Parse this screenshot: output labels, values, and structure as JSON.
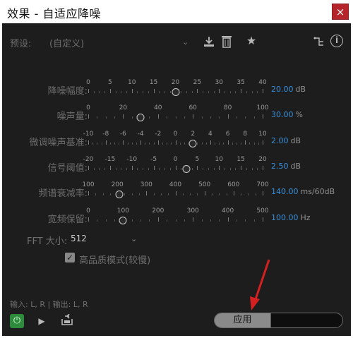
{
  "window": {
    "title": "效果 - 自适应降噪",
    "close_glyph": "×"
  },
  "toolbar": {
    "preset_label": "预设:",
    "preset_value": "(自定义)",
    "icons": [
      "chevron-down-icon",
      "download-icon",
      "trash-icon",
      "star-icon",
      "routing-icon",
      "info-icon"
    ]
  },
  "sliders": [
    {
      "label": "降噪幅度:",
      "ticks": [
        "0",
        "5",
        "10",
        "15",
        "20",
        "25",
        "30",
        "35",
        "40"
      ],
      "value": "20.00",
      "unit": "dB",
      "knob_fraction": 0.5
    },
    {
      "label": "噪声量:",
      "ticks": [
        "0",
        "20",
        "40",
        "60",
        "80",
        "100"
      ],
      "value": "30.00",
      "unit": "%",
      "knob_fraction": 0.3
    },
    {
      "label": "微调噪声基准:",
      "ticks": [
        "-10",
        "-8",
        "-6",
        "-4",
        "-2",
        "0",
        "2",
        "4",
        "6",
        "8",
        "10"
      ],
      "value": "2.00",
      "unit": "dB",
      "knob_fraction": 0.6
    },
    {
      "label": "信号阈值:",
      "ticks": [
        "-20",
        "-15",
        "-10",
        "-5",
        "0",
        "5",
        "10",
        "15",
        "20"
      ],
      "value": "2.50",
      "unit": "dB",
      "knob_fraction": 0.5625
    },
    {
      "label": "频谱衰减率:",
      "ticks": [
        "100",
        "200",
        "300",
        "400",
        "500",
        "600",
        "700"
      ],
      "value": "140.00",
      "unit": "ms/60dB",
      "knob_fraction": 0.178
    },
    {
      "label": "宽频保留:",
      "ticks": [
        "0",
        "100",
        "200",
        "300",
        "400",
        "500"
      ],
      "value": "100.00",
      "unit": "Hz",
      "knob_fraction": 0.2
    }
  ],
  "fft": {
    "label": "FFT 大小:",
    "value": "512"
  },
  "hq_mode": {
    "label": "高品质模式(较慢)",
    "checked": true
  },
  "io": {
    "text": "输入: L, R | 输出: L, R"
  },
  "footer": {
    "apply_label": "应用"
  },
  "colors": {
    "accent_value": "#3a8fd8",
    "power_on": "#2e8b3d",
    "close_red": "#b5232b",
    "arrow_red": "#d42020"
  }
}
